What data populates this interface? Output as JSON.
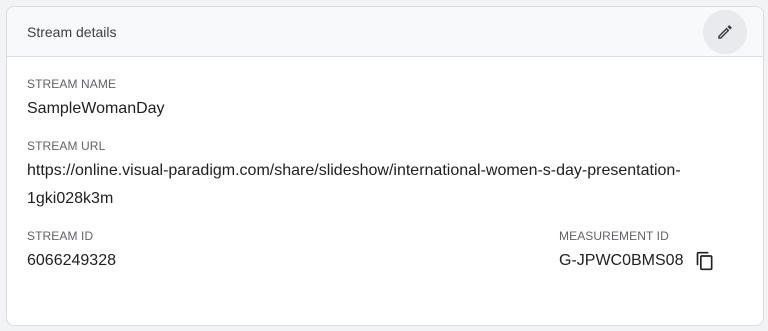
{
  "header": {
    "title": "Stream details",
    "edit_icon": "pencil-icon"
  },
  "stream_name": {
    "label": "STREAM NAME",
    "value": "SampleWomanDay"
  },
  "stream_url": {
    "label": "STREAM URL",
    "value": "https://online.visual-paradigm.com/share/slideshow/international-women-s-day-presentation-1gki028k3m"
  },
  "stream_id": {
    "label": "STREAM ID",
    "value": "6066249328"
  },
  "measurement_id": {
    "label": "MEASUREMENT ID",
    "value": "G-JPWC0BMS08",
    "copy_icon": "copy-icon"
  }
}
